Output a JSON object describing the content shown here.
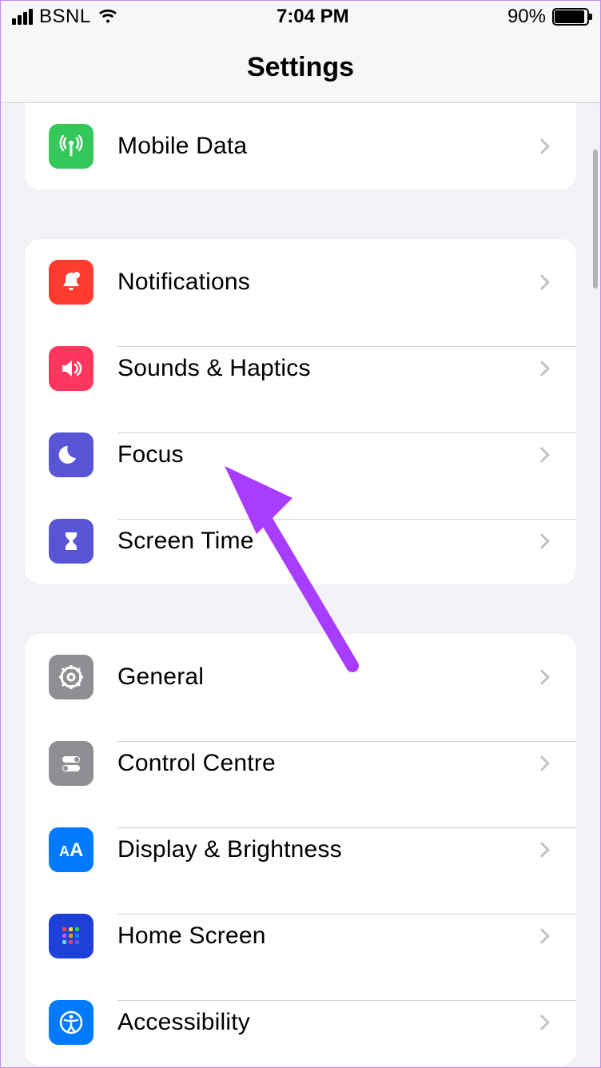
{
  "statusBar": {
    "carrier": "BSNL",
    "time": "7:04 PM",
    "batteryPercent": "90%"
  },
  "nav": {
    "title": "Settings"
  },
  "groups": [
    {
      "rows": [
        {
          "id": "mobile-data",
          "label": "Mobile Data",
          "iconColor": "green",
          "icon": "antenna"
        }
      ]
    },
    {
      "rows": [
        {
          "id": "notifications",
          "label": "Notifications",
          "iconColor": "red",
          "icon": "bell"
        },
        {
          "id": "sounds-haptics",
          "label": "Sounds & Haptics",
          "iconColor": "pink",
          "icon": "speaker"
        },
        {
          "id": "focus",
          "label": "Focus",
          "iconColor": "indigo",
          "icon": "moon"
        },
        {
          "id": "screen-time",
          "label": "Screen Time",
          "iconColor": "indigo",
          "icon": "hourglass"
        }
      ]
    },
    {
      "rows": [
        {
          "id": "general",
          "label": "General",
          "iconColor": "gray",
          "icon": "gear"
        },
        {
          "id": "control-centre",
          "label": "Control Centre",
          "iconColor": "gray",
          "icon": "toggles"
        },
        {
          "id": "display-brightness",
          "label": "Display & Brightness",
          "iconColor": "blue",
          "icon": "aa"
        },
        {
          "id": "home-screen",
          "label": "Home Screen",
          "iconColor": "deepblue",
          "icon": "grid"
        },
        {
          "id": "accessibility",
          "label": "Accessibility",
          "iconColor": "blue",
          "icon": "accessibility"
        }
      ]
    }
  ],
  "annotation": {
    "target": "focus",
    "arrowColor": "#a83cff"
  }
}
